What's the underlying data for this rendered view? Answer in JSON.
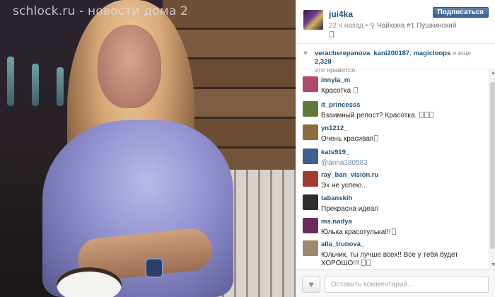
{
  "watermark": "schlock.ru - новости дома 2",
  "post": {
    "username": "jui4ka",
    "time": "22 ч назад",
    "separator": " • ",
    "location_pin": "⚲",
    "location": "Чайхона #1 Пушкинский",
    "follow_label": "Подписаться"
  },
  "likes": {
    "heart_icon": "heart-icon",
    "user1": "veracherepanova",
    "sep1": ", ",
    "user2": "kani200187",
    "sep2": ", ",
    "user3": "magicloops",
    "and_more": " и еще ",
    "count": "2,328",
    "suffix": "это нравится."
  },
  "comments": [
    {
      "user": "innyla_m",
      "text": "Красотка",
      "avatar_color": "#b04a6a",
      "glyphs": 1
    },
    {
      "user": "it_princesss",
      "text": "Взаимный репост? Красотка.",
      "avatar_color": "#5e7a3a",
      "glyphs": 3
    },
    {
      "user": "yn1212_",
      "text": "Очень красивая",
      "avatar_color": "#8f6a3e",
      "glyphs": 1
    },
    {
      "user": "kats919_",
      "text": "@anna180583",
      "avatar_color": "#3f5f8f",
      "glyphs": 0,
      "mention": true
    },
    {
      "user": "ray_ban_vision.ru",
      "text": "Эх не успею...",
      "avatar_color": "#a23b2f",
      "glyphs": 0
    },
    {
      "user": "tabanskih",
      "text": "Прекрасна идеал",
      "avatar_color": "#2e2e2e",
      "glyphs": 0
    },
    {
      "user": "ms.nadya",
      "text": "Юлька красотулька!!!",
      "avatar_color": "#6a2a5e",
      "glyphs": 1
    },
    {
      "user": "alla_trunova_",
      "text": "Юльчик, ты лучше всех!! Все у тебя будет",
      "text2": "ХОРОШО!!!",
      "avatar_color": "#9b8a70",
      "glyphs": 0,
      "glyphs2": 2
    }
  ],
  "scrollbar": {
    "up_icon": "▲",
    "down_icon": "▼"
  },
  "footer": {
    "like_icon": "♥",
    "comment_placeholder": "Оставить комментарий..."
  }
}
